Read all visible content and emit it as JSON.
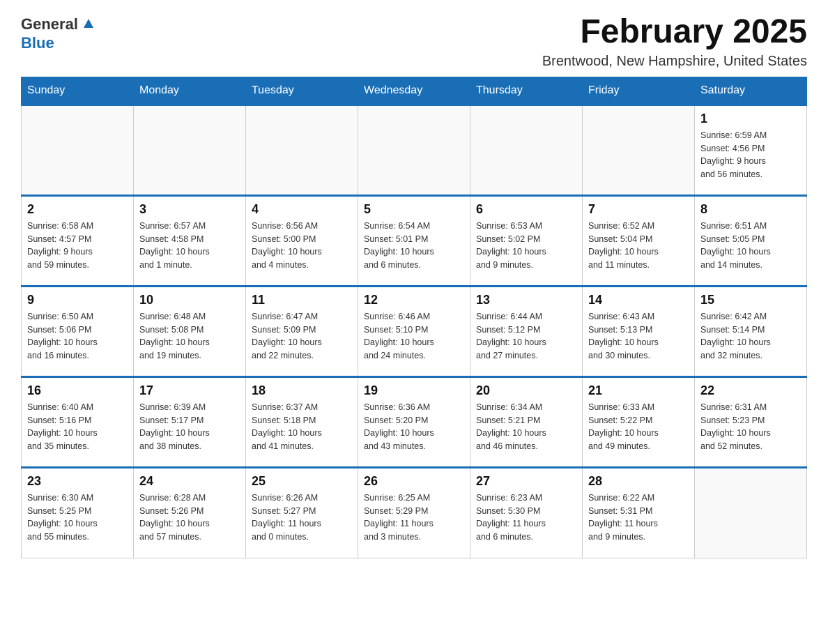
{
  "header": {
    "logo_general": "General",
    "logo_blue": "Blue",
    "title": "February 2025",
    "subtitle": "Brentwood, New Hampshire, United States"
  },
  "weekdays": [
    "Sunday",
    "Monday",
    "Tuesday",
    "Wednesday",
    "Thursday",
    "Friday",
    "Saturday"
  ],
  "weeks": [
    [
      {
        "day": "",
        "info": ""
      },
      {
        "day": "",
        "info": ""
      },
      {
        "day": "",
        "info": ""
      },
      {
        "day": "",
        "info": ""
      },
      {
        "day": "",
        "info": ""
      },
      {
        "day": "",
        "info": ""
      },
      {
        "day": "1",
        "info": "Sunrise: 6:59 AM\nSunset: 4:56 PM\nDaylight: 9 hours\nand 56 minutes."
      }
    ],
    [
      {
        "day": "2",
        "info": "Sunrise: 6:58 AM\nSunset: 4:57 PM\nDaylight: 9 hours\nand 59 minutes."
      },
      {
        "day": "3",
        "info": "Sunrise: 6:57 AM\nSunset: 4:58 PM\nDaylight: 10 hours\nand 1 minute."
      },
      {
        "day": "4",
        "info": "Sunrise: 6:56 AM\nSunset: 5:00 PM\nDaylight: 10 hours\nand 4 minutes."
      },
      {
        "day": "5",
        "info": "Sunrise: 6:54 AM\nSunset: 5:01 PM\nDaylight: 10 hours\nand 6 minutes."
      },
      {
        "day": "6",
        "info": "Sunrise: 6:53 AM\nSunset: 5:02 PM\nDaylight: 10 hours\nand 9 minutes."
      },
      {
        "day": "7",
        "info": "Sunrise: 6:52 AM\nSunset: 5:04 PM\nDaylight: 10 hours\nand 11 minutes."
      },
      {
        "day": "8",
        "info": "Sunrise: 6:51 AM\nSunset: 5:05 PM\nDaylight: 10 hours\nand 14 minutes."
      }
    ],
    [
      {
        "day": "9",
        "info": "Sunrise: 6:50 AM\nSunset: 5:06 PM\nDaylight: 10 hours\nand 16 minutes."
      },
      {
        "day": "10",
        "info": "Sunrise: 6:48 AM\nSunset: 5:08 PM\nDaylight: 10 hours\nand 19 minutes."
      },
      {
        "day": "11",
        "info": "Sunrise: 6:47 AM\nSunset: 5:09 PM\nDaylight: 10 hours\nand 22 minutes."
      },
      {
        "day": "12",
        "info": "Sunrise: 6:46 AM\nSunset: 5:10 PM\nDaylight: 10 hours\nand 24 minutes."
      },
      {
        "day": "13",
        "info": "Sunrise: 6:44 AM\nSunset: 5:12 PM\nDaylight: 10 hours\nand 27 minutes."
      },
      {
        "day": "14",
        "info": "Sunrise: 6:43 AM\nSunset: 5:13 PM\nDaylight: 10 hours\nand 30 minutes."
      },
      {
        "day": "15",
        "info": "Sunrise: 6:42 AM\nSunset: 5:14 PM\nDaylight: 10 hours\nand 32 minutes."
      }
    ],
    [
      {
        "day": "16",
        "info": "Sunrise: 6:40 AM\nSunset: 5:16 PM\nDaylight: 10 hours\nand 35 minutes."
      },
      {
        "day": "17",
        "info": "Sunrise: 6:39 AM\nSunset: 5:17 PM\nDaylight: 10 hours\nand 38 minutes."
      },
      {
        "day": "18",
        "info": "Sunrise: 6:37 AM\nSunset: 5:18 PM\nDaylight: 10 hours\nand 41 minutes."
      },
      {
        "day": "19",
        "info": "Sunrise: 6:36 AM\nSunset: 5:20 PM\nDaylight: 10 hours\nand 43 minutes."
      },
      {
        "day": "20",
        "info": "Sunrise: 6:34 AM\nSunset: 5:21 PM\nDaylight: 10 hours\nand 46 minutes."
      },
      {
        "day": "21",
        "info": "Sunrise: 6:33 AM\nSunset: 5:22 PM\nDaylight: 10 hours\nand 49 minutes."
      },
      {
        "day": "22",
        "info": "Sunrise: 6:31 AM\nSunset: 5:23 PM\nDaylight: 10 hours\nand 52 minutes."
      }
    ],
    [
      {
        "day": "23",
        "info": "Sunrise: 6:30 AM\nSunset: 5:25 PM\nDaylight: 10 hours\nand 55 minutes."
      },
      {
        "day": "24",
        "info": "Sunrise: 6:28 AM\nSunset: 5:26 PM\nDaylight: 10 hours\nand 57 minutes."
      },
      {
        "day": "25",
        "info": "Sunrise: 6:26 AM\nSunset: 5:27 PM\nDaylight: 11 hours\nand 0 minutes."
      },
      {
        "day": "26",
        "info": "Sunrise: 6:25 AM\nSunset: 5:29 PM\nDaylight: 11 hours\nand 3 minutes."
      },
      {
        "day": "27",
        "info": "Sunrise: 6:23 AM\nSunset: 5:30 PM\nDaylight: 11 hours\nand 6 minutes."
      },
      {
        "day": "28",
        "info": "Sunrise: 6:22 AM\nSunset: 5:31 PM\nDaylight: 11 hours\nand 9 minutes."
      },
      {
        "day": "",
        "info": ""
      }
    ]
  ]
}
